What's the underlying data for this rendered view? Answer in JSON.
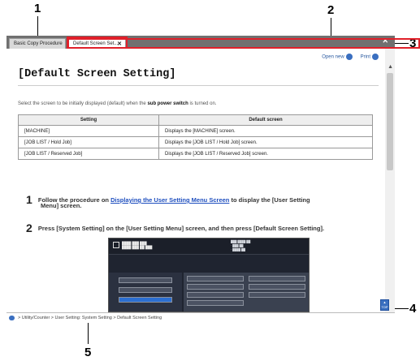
{
  "callouts": {
    "c1": "1",
    "c2": "2",
    "c3": "3",
    "c4": "4",
    "c5": "5"
  },
  "tabs": [
    {
      "label": "Basic Copy Procedure"
    },
    {
      "label": "Default Screen Set...",
      "close": "✕"
    }
  ],
  "toolbar": {
    "open_new": "Open new",
    "print": "Print"
  },
  "page": {
    "title": "[Default Screen Setting]",
    "intro_prefix": "Select the screen to be initially displayed (default) when the",
    "intro_bold": "sub power switch",
    "intro_suffix": "is turned on."
  },
  "table": {
    "headers": [
      "Setting",
      "Default screen"
    ],
    "rows": [
      [
        "[MACHINE]",
        "Displays the [MACHINE] screen."
      ],
      [
        "[JOB LIST / Hold Job]",
        "Displays the [JOB LIST / Hold Job] screen."
      ],
      [
        "[JOB LIST / Reserved Job]",
        "Displays the [JOB LIST / Reserved Job] screen."
      ]
    ]
  },
  "steps": {
    "s1_num": "1",
    "s1_pre": "Follow the procedure on",
    "s1_link": "Displaying the User Setting Menu Screen",
    "s1_post": "to display the [User Setting",
    "s1_line2": "Menu] screen.",
    "s2_num": "2",
    "s2_text": "Press [System Setting] on the [User Setting Menu] screen, and then press [Default Screen Setting]."
  },
  "footer": {
    "breadcrumb": "> Utility/Counter > User Setting: System Setting > Default Screen Setting"
  },
  "top_button": "TOP"
}
